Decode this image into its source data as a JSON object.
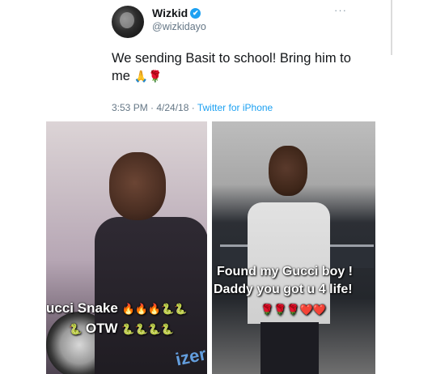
{
  "tweet": {
    "name": "Wizkid",
    "verified_glyph": "✔",
    "handle": "@wizkidayo",
    "more": "···",
    "text": "We sending Basit to school! Bring him to me",
    "emojis": "🙏🌹",
    "time": "3:53 PM · 4/24/18 · ",
    "via": "Twitter for iPhone"
  },
  "left_photo": {
    "caption_line1": "ucci Snake",
    "caption_line1_emojis": "🔥🔥🔥🐍🐍",
    "caption_line2": "OTW",
    "caption_line2_prefix": "🐍",
    "caption_line2_emojis": "🐍🐍🐍🐍",
    "watermark": "izer"
  },
  "right_photo": {
    "caption_line1": "Found my Gucci boy !",
    "caption_line2": "Daddy you got u 4 life!",
    "caption_emojis": "🌹🌹🌹❤️❤️"
  },
  "colors": {
    "accent": "#1da1f2",
    "text_secondary": "#657786"
  }
}
